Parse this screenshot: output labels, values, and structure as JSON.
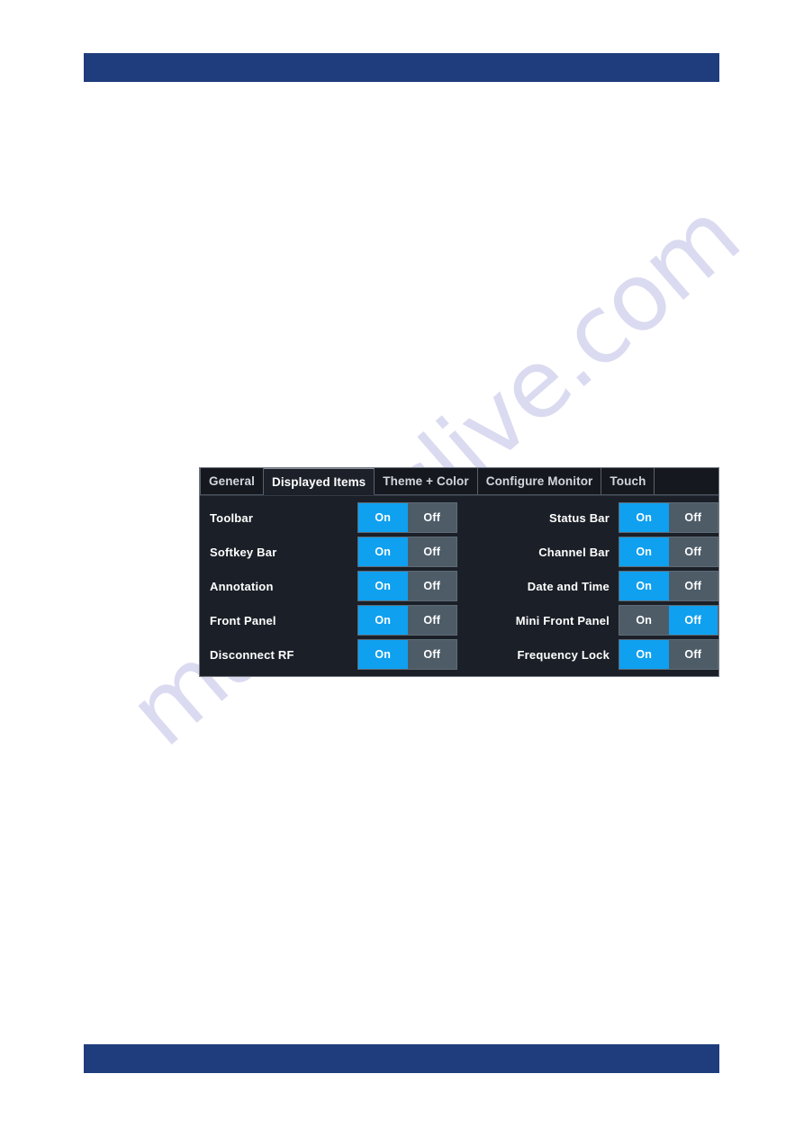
{
  "page": {
    "watermark_text": "manualslive.com",
    "rule_color": "#1f3d7c"
  },
  "dialog": {
    "tabs": [
      {
        "label": "General",
        "active": false
      },
      {
        "label": "Displayed Items",
        "active": true
      },
      {
        "label": "Theme + Color",
        "active": false
      },
      {
        "label": "Configure Monitor",
        "active": false
      },
      {
        "label": "Touch",
        "active": false
      }
    ],
    "toggle": {
      "on_label": "On",
      "off_label": "Off",
      "selected_color": "#0fa0f0",
      "track_color": "#4e5c68"
    },
    "left_column": [
      {
        "label": "Toolbar",
        "value": "On"
      },
      {
        "label": "Softkey Bar",
        "value": "On"
      },
      {
        "label": "Annotation",
        "value": "On"
      },
      {
        "label": "Front Panel",
        "value": "On"
      },
      {
        "label": "Disconnect RF",
        "value": "On"
      }
    ],
    "right_column": [
      {
        "label": "Status Bar",
        "value": "On"
      },
      {
        "label": "Channel Bar",
        "value": "On"
      },
      {
        "label": "Date and Time",
        "value": "On"
      },
      {
        "label": "Mini Front Panel",
        "value": "Off"
      },
      {
        "label": "Frequency Lock",
        "value": "On"
      }
    ]
  }
}
